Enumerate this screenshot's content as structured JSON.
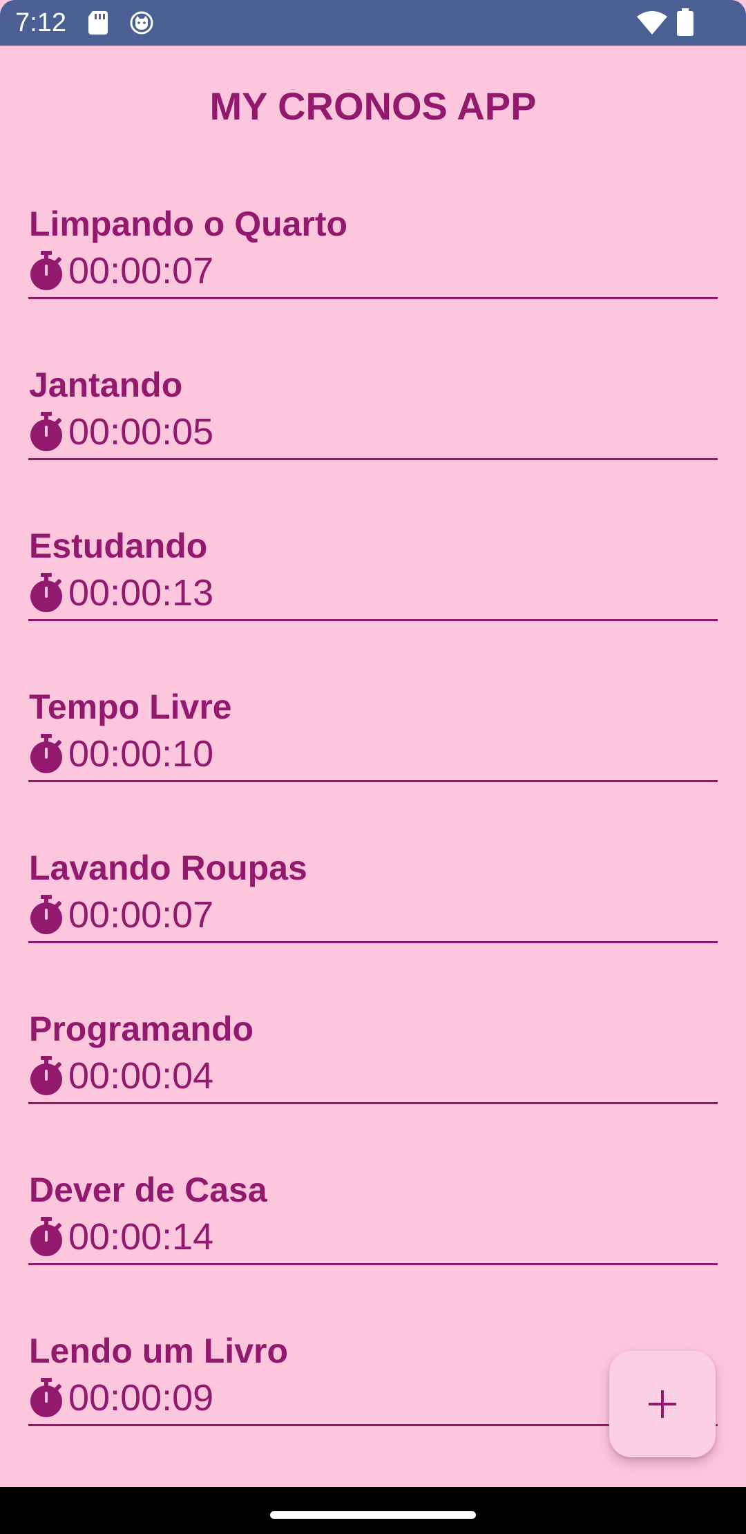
{
  "status_bar": {
    "time": "7:12",
    "icons": [
      "sd-card-icon",
      "cat-notification-icon",
      "wifi-icon",
      "battery-icon"
    ]
  },
  "app": {
    "title": "MY CRONOS APP"
  },
  "activities": [
    {
      "name": "Limpando o Quarto",
      "elapsed": "00:00:07"
    },
    {
      "name": "Jantando",
      "elapsed": "00:00:05"
    },
    {
      "name": "Estudando",
      "elapsed": "00:00:13"
    },
    {
      "name": "Tempo Livre",
      "elapsed": "00:00:10"
    },
    {
      "name": "Lavando Roupas",
      "elapsed": "00:00:07"
    },
    {
      "name": "Programando",
      "elapsed": "00:00:04"
    },
    {
      "name": "Dever de Casa",
      "elapsed": "00:00:14"
    },
    {
      "name": "Lendo um Livro",
      "elapsed": "00:00:09"
    }
  ],
  "fab": {
    "icon": "plus-icon"
  },
  "colors": {
    "background": "#fcc7dc",
    "accent": "#93196e",
    "status_bar": "#4a5f94",
    "fab": "#fdd1e3"
  }
}
